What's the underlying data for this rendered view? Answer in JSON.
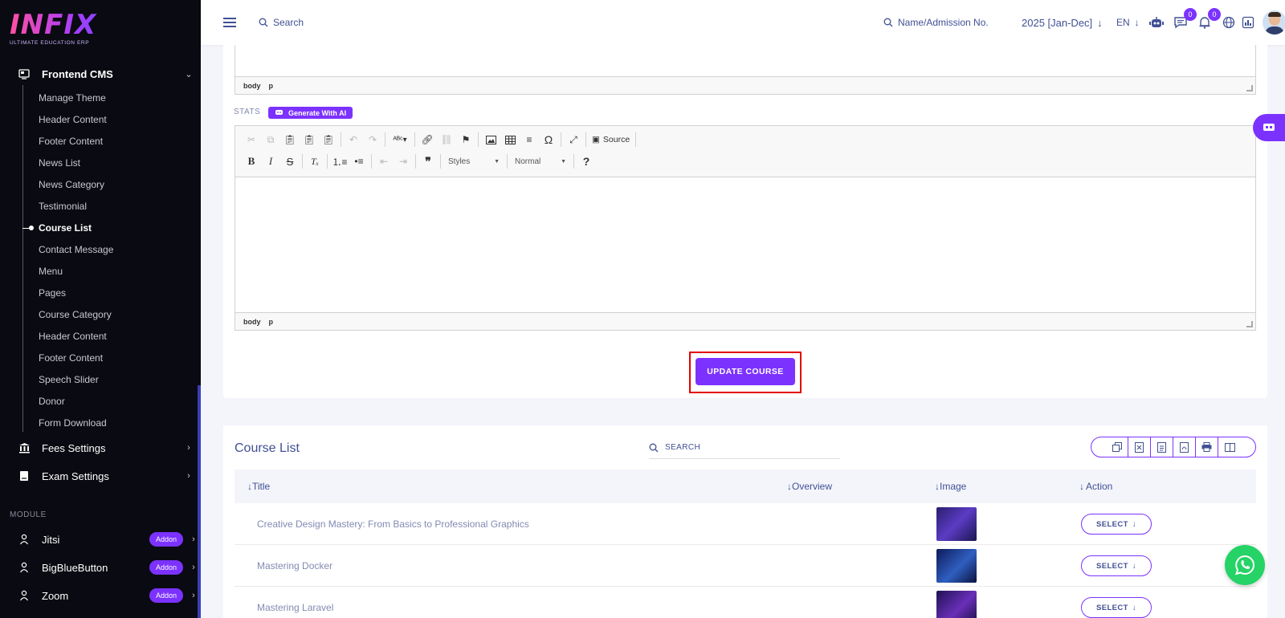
{
  "brand": {
    "logo_text": "INFIX",
    "tagline": "ULTIMATE EDUCATION ERP"
  },
  "sidebar": {
    "frontend_cms": "Frontend CMS",
    "items": [
      "Manage Theme",
      "Header Content",
      "Footer Content",
      "News List",
      "News Category",
      "Testimonial",
      "Course List",
      "Contact Message",
      "Menu",
      "Pages",
      "Course Category",
      "Header Content",
      "Footer Content",
      "Speech Slider",
      "Donor",
      "Form Download"
    ],
    "active_item": "Course List",
    "fees_settings": "Fees Settings",
    "exam_settings": "Exam Settings",
    "module_heading": "MODULE",
    "modules": [
      {
        "label": "Jitsi",
        "badge": "Addon"
      },
      {
        "label": "BigBlueButton",
        "badge": "Addon"
      },
      {
        "label": "Zoom",
        "badge": "Addon"
      }
    ]
  },
  "topbar": {
    "search_placeholder": "Search",
    "student_search": "Name/Admission No.",
    "session": "2025 [Jan-Dec]",
    "language": "EN",
    "messages_count": "0",
    "notifications_count": "0"
  },
  "editor": {
    "path_tags": [
      "body",
      "p"
    ],
    "stats_label": "STATS",
    "generate_ai": "Generate With AI",
    "source_label": "Source",
    "styles_combo": "Styles",
    "format_combo": "Normal",
    "update_button": "UPDATE COURSE"
  },
  "course_list": {
    "title": "Course List",
    "search_placeholder": "SEARCH",
    "columns": [
      "Title",
      "Overview",
      "Image",
      "Action"
    ],
    "rows": [
      {
        "title": "Creative Design Mastery: From Basics to Professional Graphics",
        "action": "SELECT"
      },
      {
        "title": "Mastering Docker",
        "action": "SELECT"
      },
      {
        "title": "Mastering Laravel",
        "action": "SELECT"
      }
    ]
  },
  "colors": {
    "accent": "#7c32ff",
    "sidebar_bg": "#0a0a12",
    "highlight": "#e30000",
    "whatsapp": "#25d366"
  }
}
